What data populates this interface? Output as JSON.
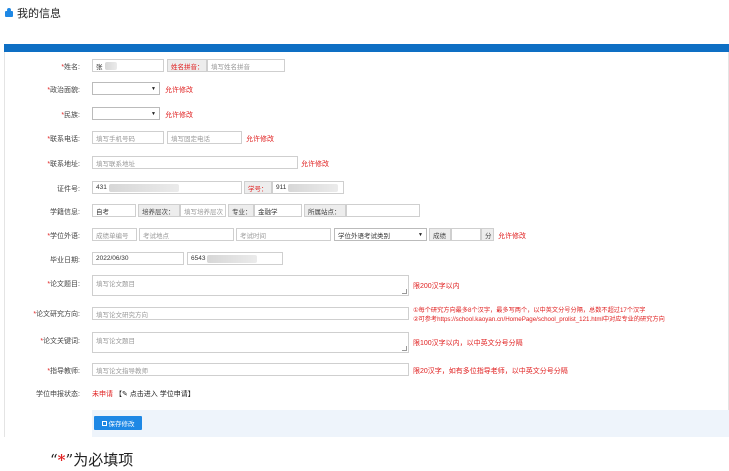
{
  "page": {
    "title": "我的信息"
  },
  "form": {
    "name": {
      "label": "姓名:",
      "value": "张",
      "pinyin_tag": "姓名拼音：",
      "pinyin_placeholder": "填写姓名拼音"
    },
    "politics": {
      "label": "政治面貌:",
      "value": "",
      "note": "允许修改"
    },
    "ethnicity": {
      "label": "民族:",
      "value": "",
      "note": "允许修改"
    },
    "phone": {
      "label": "联系电话:",
      "mobile_placeholder": "填写手机号码",
      "landline_placeholder": "填写固定电话",
      "note": "允许修改"
    },
    "address": {
      "label": "联系地址:",
      "placeholder": "填写联系地址",
      "note": "允许修改"
    },
    "id": {
      "label": "证件号:",
      "value": "431",
      "student_no_tag": "学号：",
      "student_no_value": "911"
    },
    "education": {
      "label": "学籍信息:",
      "value": "自考",
      "level_tag": "培养层次：",
      "level_placeholder": "填写培养层次",
      "major_tag": "专业：",
      "major_value": "金融学",
      "station_tag": "所属站点：",
      "station_value": ""
    },
    "degree_language": {
      "label": "学位外语:",
      "cert_placeholder": "成绩单编号",
      "location_placeholder": "考试地点",
      "time_placeholder": "考试时间",
      "category_value": "学位外语考试类别",
      "score_tag": "成绩",
      "score_value": "",
      "score_unit": "分",
      "note": "允许修改"
    },
    "graduation": {
      "label": "毕业日期:",
      "date_value": "2022/06/30",
      "cert_value": "6543"
    },
    "thesis_title": {
      "label": "论文题目:",
      "placeholder": "填写论文题目",
      "note": "限200汉字以内"
    },
    "research_direction": {
      "label": "论文研究方向:",
      "placeholder": "填写论文研究方向",
      "note_line1": "①每个研究方向最多8个汉字，最多写两个，以中英文分号分隔，总数不超过17个汉字",
      "note_line2": "②可参考https://school.kaoyan.cn/HomePage/school_prolist_121.html中对应专业的研究方向"
    },
    "keywords": {
      "label": "论文关键词:",
      "placeholder": "填写论文题目",
      "note": "限100汉字以内，以中英文分号分隔"
    },
    "advisor": {
      "label": "指导教师:",
      "placeholder": "填写论文指导教师",
      "note": "限20汉字，如有多位指导老师，以中英文分号分隔"
    },
    "status": {
      "label": "学位申报状态:",
      "value": "未申请",
      "link_text": "【✎ 点击进入 学位申请】"
    }
  },
  "actions": {
    "save_label": "保存修改"
  },
  "legend": {
    "open_quote": "“",
    "star": "*",
    "close_quote": "”",
    "text": "为必填项"
  },
  "colors": {
    "accent": "#1e88e5",
    "header_bar": "#0e6fc4",
    "required": "#e02020"
  }
}
